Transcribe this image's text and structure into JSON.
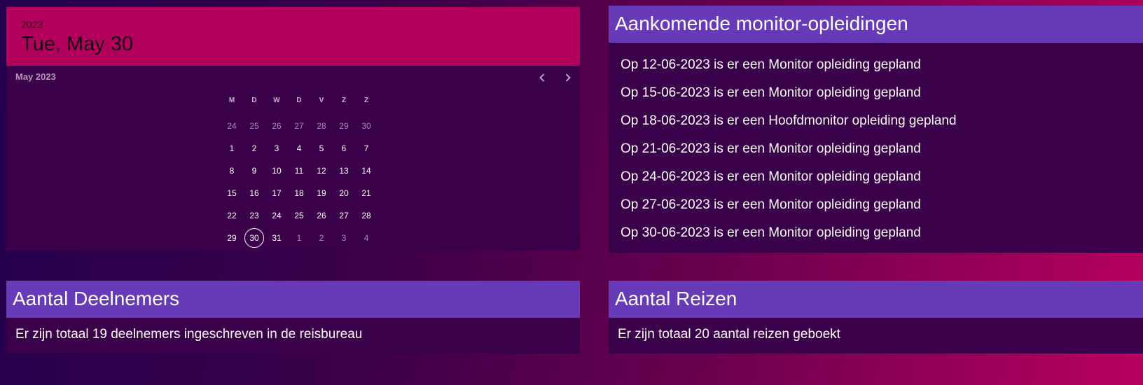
{
  "calendar": {
    "year": "2023",
    "selected_date": "Tue, May 30",
    "month_label": "May 2023",
    "weekdays": [
      "M",
      "D",
      "W",
      "D",
      "V",
      "Z",
      "Z"
    ],
    "weeks": [
      [
        {
          "d": "24",
          "m": true
        },
        {
          "d": "25",
          "m": true
        },
        {
          "d": "26",
          "m": true
        },
        {
          "d": "27",
          "m": true
        },
        {
          "d": "28",
          "m": true
        },
        {
          "d": "29",
          "m": true
        },
        {
          "d": "30",
          "m": true
        }
      ],
      [
        {
          "d": "1"
        },
        {
          "d": "2"
        },
        {
          "d": "3"
        },
        {
          "d": "4"
        },
        {
          "d": "5"
        },
        {
          "d": "6"
        },
        {
          "d": "7"
        }
      ],
      [
        {
          "d": "8"
        },
        {
          "d": "9"
        },
        {
          "d": "10"
        },
        {
          "d": "11"
        },
        {
          "d": "12"
        },
        {
          "d": "13"
        },
        {
          "d": "14"
        }
      ],
      [
        {
          "d": "15"
        },
        {
          "d": "16"
        },
        {
          "d": "17"
        },
        {
          "d": "18"
        },
        {
          "d": "19"
        },
        {
          "d": "20"
        },
        {
          "d": "21"
        }
      ],
      [
        {
          "d": "22"
        },
        {
          "d": "23"
        },
        {
          "d": "24"
        },
        {
          "d": "25"
        },
        {
          "d": "26"
        },
        {
          "d": "27"
        },
        {
          "d": "28"
        }
      ],
      [
        {
          "d": "29"
        },
        {
          "d": "30",
          "today": true
        },
        {
          "d": "31"
        },
        {
          "d": "1",
          "m": true
        },
        {
          "d": "2",
          "m": true
        },
        {
          "d": "3",
          "m": true
        },
        {
          "d": "4",
          "m": true
        }
      ]
    ],
    "prev_icon": "chevron-left-icon",
    "next_icon": "chevron-right-icon"
  },
  "trainings": {
    "title": "Aankomende monitor-opleidingen",
    "items": [
      "Op 12-06-2023 is er een Monitor opleiding gepland",
      "Op 15-06-2023 is er een Monitor opleiding gepland",
      "Op 18-06-2023 is er een Hoofdmonitor opleiding gepland",
      "Op 21-06-2023 is er een Monitor opleiding gepland",
      "Op 24-06-2023 is er een Monitor opleiding gepland",
      "Op 27-06-2023 is er een Monitor opleiding gepland",
      "Op 30-06-2023 is er een Monitor opleiding gepland"
    ]
  },
  "participants": {
    "title": "Aantal Deelnemers",
    "text": "Er zijn totaal 19 deelnemers ingeschreven in de reisbureau"
  },
  "trips": {
    "title": "Aantal Reizen",
    "text": "Er zijn totaal 20 aantal reizen geboekt"
  },
  "colors": {
    "header_pink": "#b3005c",
    "panel_purple": "#673ab7",
    "body_dark": "#3a004a"
  }
}
